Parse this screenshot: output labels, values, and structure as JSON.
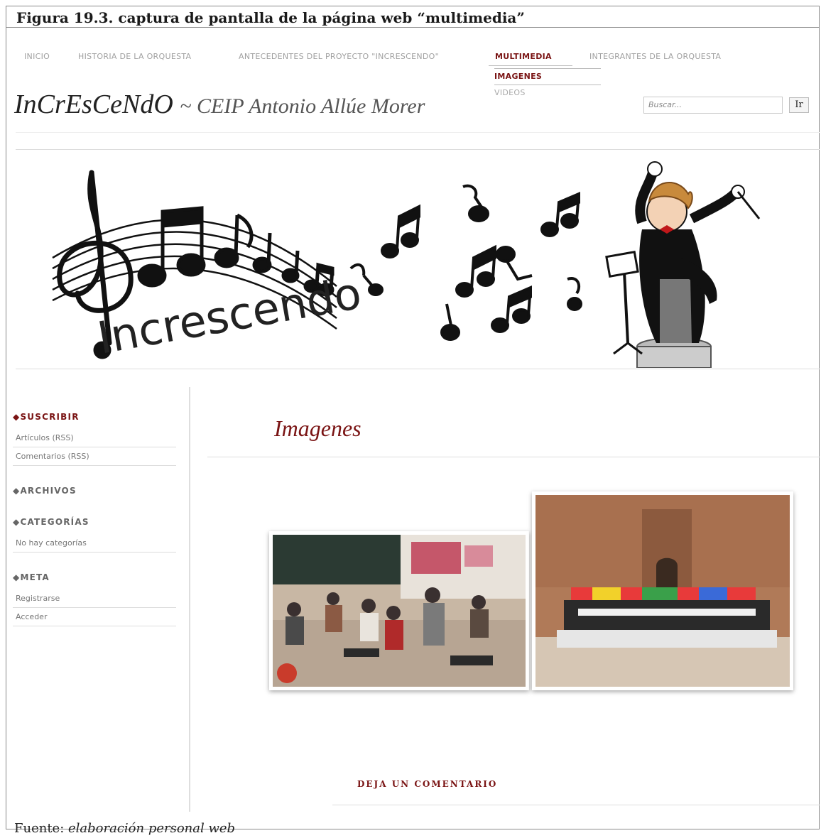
{
  "caption": "Figura 19.3. captura de pantalla de la página web “multimedia”",
  "source_prefix": "Fuente: ",
  "source_italic": "elaboración personal web",
  "nav": {
    "items": [
      {
        "label": "INICIO"
      },
      {
        "label": "HISTORIA DE LA ORQUESTA"
      },
      {
        "label": "ANTECEDENTES DEL PROYECTO \"INCRESCENDO\""
      },
      {
        "label": "MULTIMEDIA"
      },
      {
        "label": "INTEGRANTES DE LA ORQUESTA"
      }
    ],
    "submenu": [
      {
        "label": "IMAGENES"
      },
      {
        "label": "VIDEOS"
      }
    ]
  },
  "site": {
    "title": "InCrEsCeNdO",
    "subtitle": "~ CEIP Antonio Allúe Morer"
  },
  "search": {
    "placeholder": "Buscar...",
    "button": "Ir"
  },
  "banner": {
    "word": "Increscendo"
  },
  "sidebar": {
    "sections": [
      {
        "title": "SUSCRIBIR",
        "items": [
          "Artículos (RSS)",
          "Comentarios (RSS)"
        ]
      },
      {
        "title": "ARCHIVOS",
        "items": []
      },
      {
        "title": "CATEGORÍAS",
        "items": [
          "No hay categorías"
        ]
      },
      {
        "title": "META",
        "items": [
          "Registrarse",
          "Acceder"
        ]
      }
    ]
  },
  "main": {
    "heading": "Imagenes",
    "comment_link": "DEJA UN COMENTARIO"
  },
  "colors": {
    "accent": "#7a1414",
    "nav_gray": "#a0a0a0"
  }
}
